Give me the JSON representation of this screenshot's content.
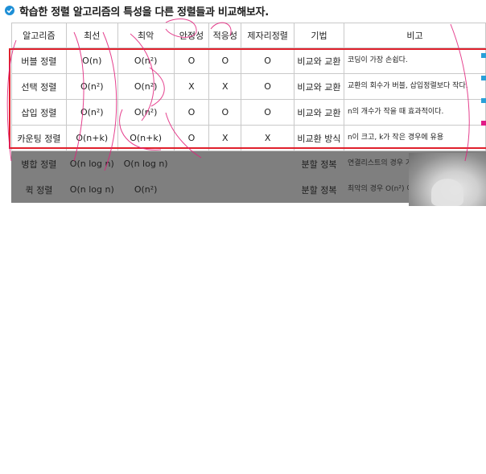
{
  "title": "학습한 정렬 알고리즘의 특성을 다른 정렬들과 비교해보자.",
  "table": {
    "headers": [
      "알고리즘",
      "최선",
      "최악",
      "안정성",
      "적응성",
      "제자리정렬",
      "기법",
      "비고"
    ],
    "rows": [
      [
        "버블 정렬",
        "O(n)",
        "O(n²)",
        "O",
        "O",
        "O",
        "비교와 교환",
        "코딩이 가장 손쉽다."
      ],
      [
        "선택 정렬",
        "O(n²)",
        "O(n²)",
        "X",
        "X",
        "O",
        "비교와 교환",
        "교환의 회수가 버블, 삽입정렬보다 작다."
      ],
      [
        "삽입 정렬",
        "O(n²)",
        "O(n²)",
        "O",
        "O",
        "O",
        "비교와 교환",
        "n의 개수가 작을 때 효과적이다."
      ],
      [
        "카운팅 정렬",
        "O(n+k)",
        "O(n+k)",
        "O",
        "X",
        "X",
        "비교환 방식",
        "n이 크고, k가 작은 경우에 유용"
      ],
      [
        "병합 정렬",
        "O(n log n)",
        "O(n log n)",
        "",
        "",
        "",
        "분할 정복",
        "연결리스트의 경우 가"
      ],
      [
        "퀵 정렬",
        "O(n log n)",
        "O(n²)",
        "",
        "",
        "",
        "분할 정복",
        "최악의 경우 O(n²) 이 평균적으로는 가장 빠"
      ]
    ]
  },
  "colors": {
    "accent": "#1e8fd6",
    "highlight_box": "#e0202c",
    "annotation_ink": "#e0207a",
    "dimmed_row": "#7f7f7f"
  },
  "icons": {
    "title_bullet": "check-circle-icon"
  }
}
